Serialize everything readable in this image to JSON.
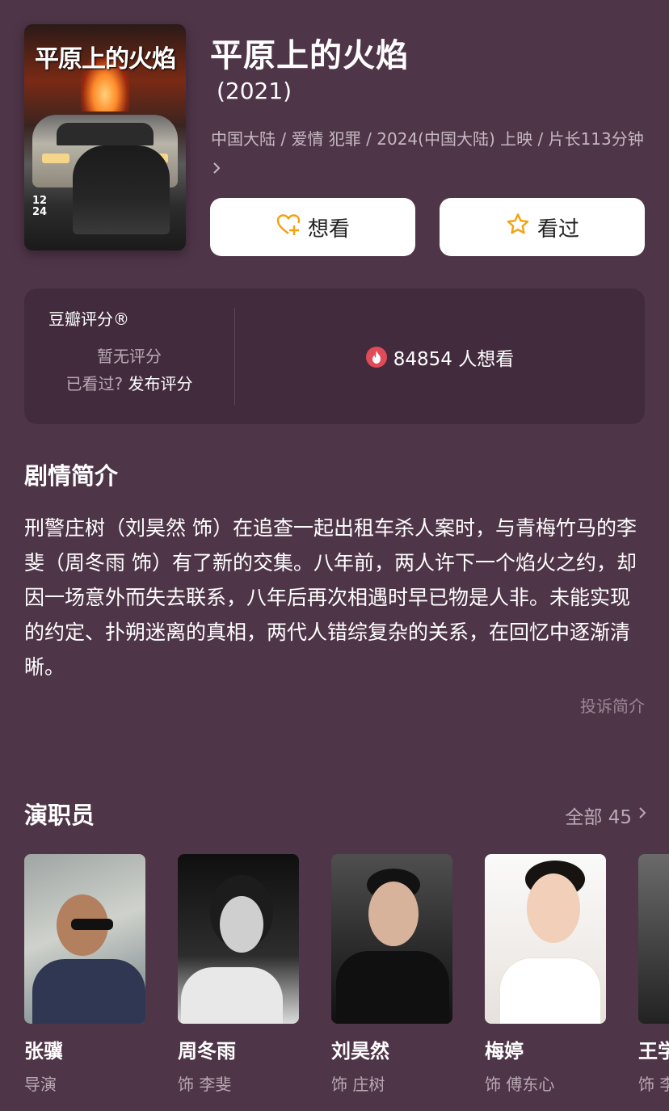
{
  "poster": {
    "title_text": "平原上的火焰",
    "date_text": "12\n24"
  },
  "movie": {
    "title": "平原上的火焰",
    "year": "(2021)",
    "meta": "中国大陆 / 爱情 犯罪 / 2024(中国大陆) 上映 / 片长113分钟"
  },
  "actions": {
    "want_label": "想看",
    "seen_label": "看过"
  },
  "rating": {
    "label": "豆瓣评分®",
    "none_text": "暂无评分",
    "seen_question": "已看过?",
    "publish_label": "发布评分",
    "wish_count": "84854 人想看"
  },
  "synopsis": {
    "heading": "剧情简介",
    "text": "刑警庄树（刘昊然 饰）在追查一起出租车杀人案时，与青梅竹马的李斐（周冬雨 饰）有了新的交集。八年前，两人许下一个焰火之约，却因一场意外而失去联系，八年后再次相遇时早已物是人非。未能实现的约定、扑朔迷离的真相，两代人错综复杂的关系，在回忆中逐渐清晰。",
    "report_label": "投诉简介"
  },
  "cast": {
    "heading": "演职员",
    "all_label": "全部 45",
    "members": [
      {
        "name": "张骥",
        "role": "导演"
      },
      {
        "name": "周冬雨",
        "role": "饰 李斐"
      },
      {
        "name": "刘昊然",
        "role": "饰 庄树"
      },
      {
        "name": "梅婷",
        "role": "饰 傅东心"
      },
      {
        "name": "王学",
        "role": "饰 李"
      }
    ]
  },
  "colors": {
    "background": "#4f3548",
    "card": "#432b3e",
    "accent_orange": "#f4a10c",
    "flame_red": "#e24a58"
  },
  "icons": [
    "heart-plus-icon",
    "star-icon",
    "flame-icon",
    "chevron-right-icon"
  ]
}
